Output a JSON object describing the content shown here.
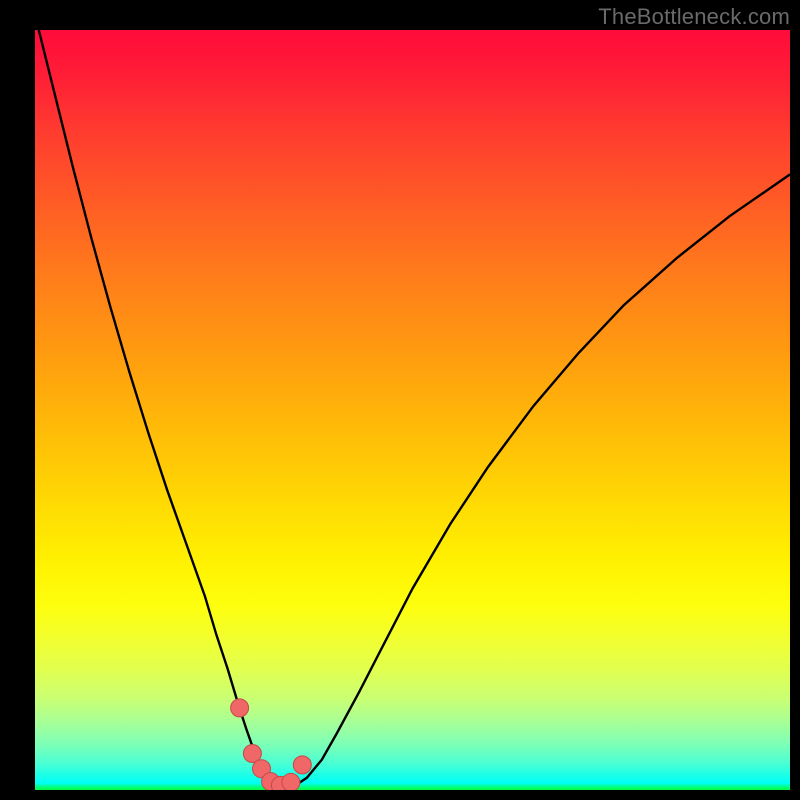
{
  "watermark": "TheBottleneck.com",
  "colors": {
    "frame": "#000000",
    "curve_stroke": "#000000",
    "marker_fill": "#f06767",
    "marker_stroke": "#c74848"
  },
  "chart_data": {
    "type": "line",
    "title": "",
    "xlabel": "",
    "ylabel": "",
    "xlim": [
      0,
      100
    ],
    "ylim": [
      0,
      100
    ],
    "grid": false,
    "legend": false,
    "background": "red-yellow-green vertical gradient (bottleneck heat scale)",
    "series": [
      {
        "name": "bottleneck-curve",
        "x": [
          0.0,
          2.5,
          5.0,
          7.5,
          10.0,
          12.5,
          15.0,
          17.5,
          20.0,
          22.5,
          24.0,
          25.5,
          27.0,
          28.0,
          29.0,
          30.0,
          31.0,
          32.0,
          33.0,
          34.5,
          36.0,
          38.0,
          40.0,
          43.0,
          46.0,
          50.0,
          55.0,
          60.0,
          66.0,
          72.0,
          78.0,
          85.0,
          92.0,
          100.0
        ],
        "y": [
          102.0,
          92.0,
          82.0,
          72.5,
          63.5,
          55.0,
          47.0,
          39.5,
          32.5,
          25.5,
          20.5,
          16.0,
          11.0,
          8.0,
          5.2,
          3.0,
          1.4,
          0.5,
          0.2,
          0.6,
          1.6,
          4.0,
          7.5,
          13.0,
          18.8,
          26.5,
          35.0,
          42.5,
          50.5,
          57.5,
          63.8,
          70.0,
          75.5,
          81.0
        ]
      }
    ],
    "markers": {
      "name": "highlighted-points",
      "x": [
        27.1,
        28.8,
        30.0,
        31.2,
        32.5,
        33.9,
        35.4
      ],
      "y": [
        10.8,
        4.8,
        2.8,
        1.1,
        0.6,
        1.0,
        3.3
      ]
    }
  }
}
